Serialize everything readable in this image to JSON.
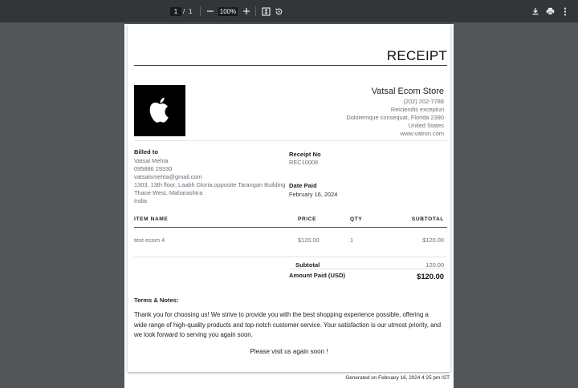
{
  "viewer": {
    "page_current": "1",
    "page_separator": "/",
    "page_total": "1",
    "zoom": "100%"
  },
  "receipt": {
    "title": "RECEIPT",
    "store": {
      "name": "Vatsal Ecom Store",
      "phone": "(202) 202-7788",
      "address1": "Reiciendis excepturi",
      "address2": "Doloremque consequat, Florida 2390",
      "country": "United States",
      "website": "www.vatron.com"
    },
    "billed_to": {
      "label": "Billed to",
      "name": "Vatsal Mehta",
      "phone": "095886 29330",
      "email": "vatsalsmehta@gmail.com",
      "address1": "1303, 13th floor, Laabh Gloria,opposite Tarangan Building",
      "address2": "Thane West, Maharashtra",
      "country": "India"
    },
    "receipt_no": {
      "label": "Receipt No",
      "value": "REC10008"
    },
    "date_paid": {
      "label": "Date Paid",
      "value": "February 16, 2024"
    },
    "table": {
      "headers": {
        "item": "ITEM NAME",
        "price": "PRICE",
        "qty": "QTY",
        "subtotal": "SUBTOTAL"
      },
      "rows": [
        {
          "item": "test ecom 4",
          "price": "$120.00",
          "qty": "1",
          "subtotal": "$120.00"
        }
      ]
    },
    "totals": {
      "subtotal_label": "Subtotal",
      "subtotal_value": "120.00",
      "paid_label": "Amount Paid (USD)",
      "paid_value": "$120.00"
    },
    "notes_title": "Terms & Notes:",
    "notes": "Thank you for choosing us! We strive to provide you with the best shopping experience possible, offering a wide range of high-quality products and top-notch customer service. Your satisfaction is our utmost priority, and we look forward to serving you again soon.",
    "thanks": "Please visit us again soon !",
    "footer": "Generated on February 16, 2024 4:25 pm IST"
  },
  "icons": {
    "zoom_out": "minus-icon",
    "zoom_in": "plus-icon",
    "fit": "fit-page-icon",
    "rotate": "rotate-icon",
    "download": "download-icon",
    "print": "print-icon",
    "more": "more-vert-icon",
    "logo": "apple-logo-icon"
  }
}
